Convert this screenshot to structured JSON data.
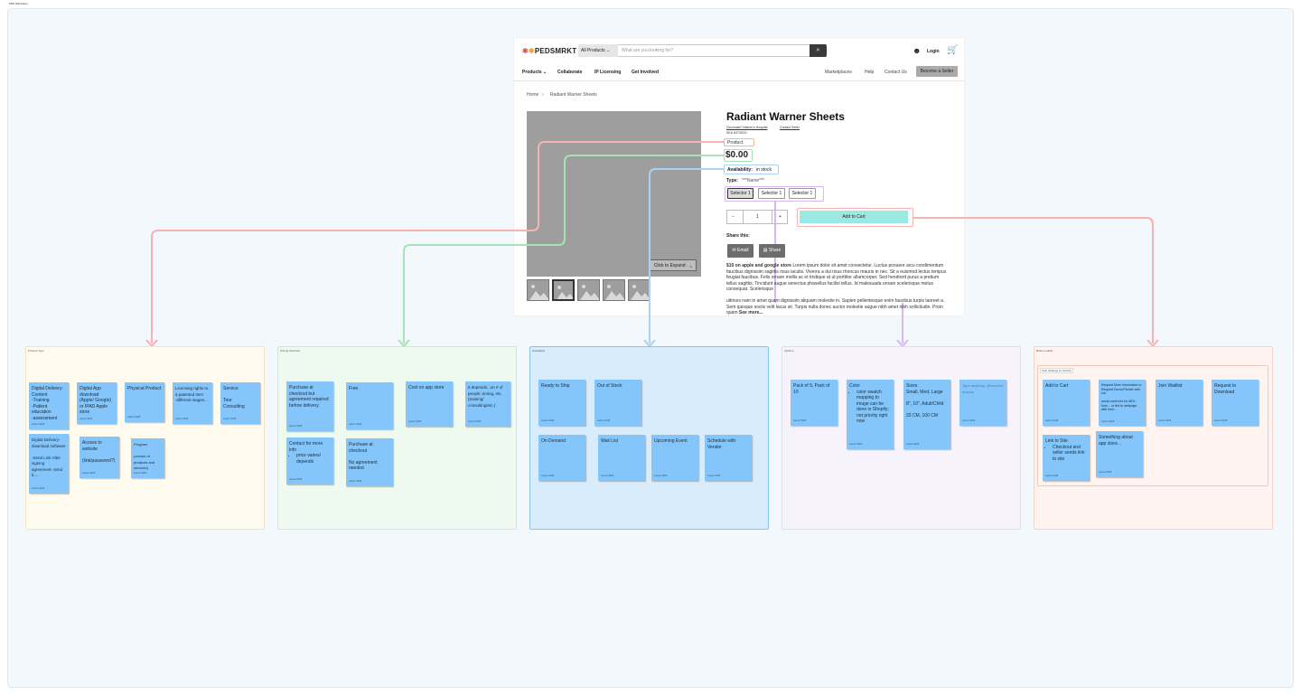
{
  "board": {
    "title": "PDP Wireframe"
  },
  "header": {
    "logo": "PEDSMRKT",
    "search_category": "All Products ⌄",
    "search_placeholder": "What are you looking for?",
    "login": "Login"
  },
  "nav": {
    "left": [
      "Products ⌄",
      "Collaborate",
      "IP Licensing",
      "Get Involved"
    ],
    "right": [
      "Marketplaces",
      "Help",
      "Contact Us"
    ],
    "cta": "Become a Seller"
  },
  "breadcrumb": {
    "home": "Home",
    "sep": "›",
    "current": "Radiant Warner Sheets"
  },
  "product": {
    "title": "Radiant Warner Sheets",
    "org": "Cincinnati Children's Hospital",
    "contact": "Contact Seller",
    "sku": "SKU 84730CD",
    "type_badge": "Product",
    "price": "$0.00",
    "availability_label": "Availability:",
    "availability_value": "in stock",
    "type_label": "Type:",
    "type_value": "***Name***",
    "selectors": [
      "Selector 1",
      "Selector 1",
      "Selector 1"
    ],
    "qty_minus": "−",
    "qty_value": "1",
    "qty_plus": "+",
    "add_to_cart": "Add to Cart",
    "share_label": "Share this:",
    "share_email": "✉ Email",
    "share_share": "▤ Share",
    "expand": "Click to Expand 🔍",
    "desc1_bold": "$10 on apple and google store",
    "desc1": " Lorem ipsum dolor sit amet consectetur. Luctus posuere arcu condimentum faucibus dignissim sagittis risus iaculis. Viverra a dui risus rhoncus mauris in nec. Sit a euismod lectus tempus feugiat faucibus. Felis ornare mollis ac et tristique at ut porttitor ullamcorper. Sed hendrerit purus a pretium tellus sagittis. Tincidunt augue senectus phasellus facilisi tellus. Id malesuada ornare scelerisque metus consequat. Scelerisque",
    "desc2": "ultrices nam in amet quam dignissim aliquam molestie in. Sapien pellentesque enim faucibus turpis laoreet a. Sem quisque sociis velit lacus sit. Turpis nulla donec auctor molestie augue nibh amet nibh sollicitudin. Proin quam ",
    "see_more": "See more..."
  },
  "sections": [
    {
      "title": "Product Type",
      "color": "#fffbee",
      "border": "#f3e6c2"
    },
    {
      "title": "Pricing Structure",
      "color": "#eefaf0",
      "border": "#cfe9d3"
    },
    {
      "title": "Availability",
      "color": "#d8ecfb",
      "border": "#84c6f0"
    },
    {
      "title": "Options",
      "color": "#f6f3fd",
      "border": "#e2dbf3"
    },
    {
      "title": "Button Labels",
      "color": "#fff4ef",
      "border": "#f4d6c8"
    }
  ],
  "inner_box_title": "Path (Dialogs for Modify)",
  "notes": {
    "s1": [
      "Digital Delivery- Content\n-Training\n-Patient education\n-assessment",
      "Digital App download (Apple/ Google) or IPAD Apple store",
      "Physical Product",
      "Licensing rights to a patented item\n-different stages...",
      "Service\n\nTour\nConsulting",
      "Digital Delivery- download software\n\n-Send Link After signing agreement- send it....",
      "Access to website\n\n(link/password?)",
      "Program\n\n(combo of products and services)"
    ],
    "s2": [
      "Purchase at checkout but agreement required before delivery",
      "Free",
      "Cost on app store",
      "It depends...on # of people, timing, etc. (training/ consulting/etc.)",
      "Contact for more info",
      "Purchase at checkout\n\nNo agreement needed"
    ],
    "s2_list": "price varies/ depends",
    "s3": [
      "Ready to Ship",
      "Out of Stock",
      "On Demand",
      "Wait List",
      "Upcoming Event",
      "Schedule with Vendor"
    ],
    "s4": [
      "Pack of 5, Pack of 10",
      "Color",
      "Sizes\nSmall, Med, Large\n\n8\", 10\", Adult/Child\n\n33 CM, 100 CM",
      "Type anything, @mention anyone"
    ],
    "s4_list": "color swatch mapping to image can be done in Shopify; not priority right now",
    "s5": [
      "Add to Cart",
      "Request More Information or Request Demo/Partner with Us!\n\nwould want info for MDL-form... or link to webpage with form...",
      "Join Waitlist",
      "Request to Download",
      "Link to Site",
      "Something about app store..."
    ],
    "s5_list": "Checkout and seller sends link to site",
    "author": "Lauren Wolff"
  },
  "colors": {
    "red": "#f6b3b0",
    "green": "#a6e2b5",
    "blue": "#a9d3f2",
    "purple": "#d6b8f3"
  }
}
